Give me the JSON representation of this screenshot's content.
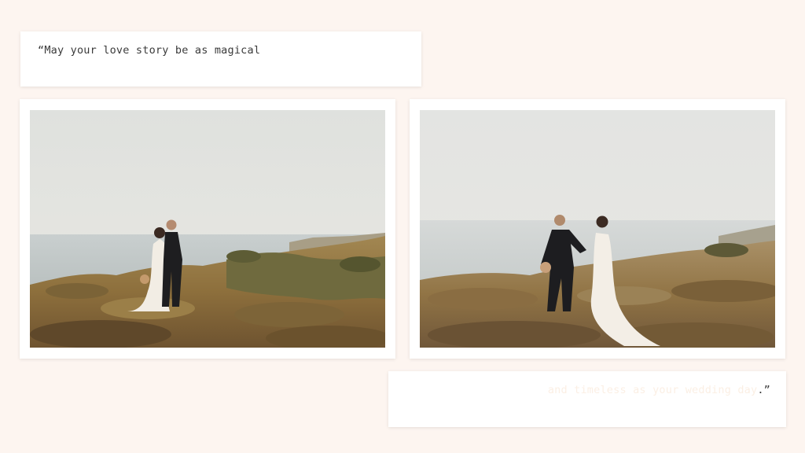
{
  "quote_top": {
    "text": "“May your love story be as magical"
  },
  "quote_bottom": {
    "faded_text": "and timeless as your wedding day",
    "closing": ".”"
  },
  "photos": [
    {
      "name": "couple-standing-photo"
    },
    {
      "name": "couple-walking-photo"
    }
  ],
  "colors": {
    "background": "#fdf5f0",
    "card": "#ffffff",
    "text": "#3a3a3a",
    "faded_text": "#fbefe4"
  }
}
